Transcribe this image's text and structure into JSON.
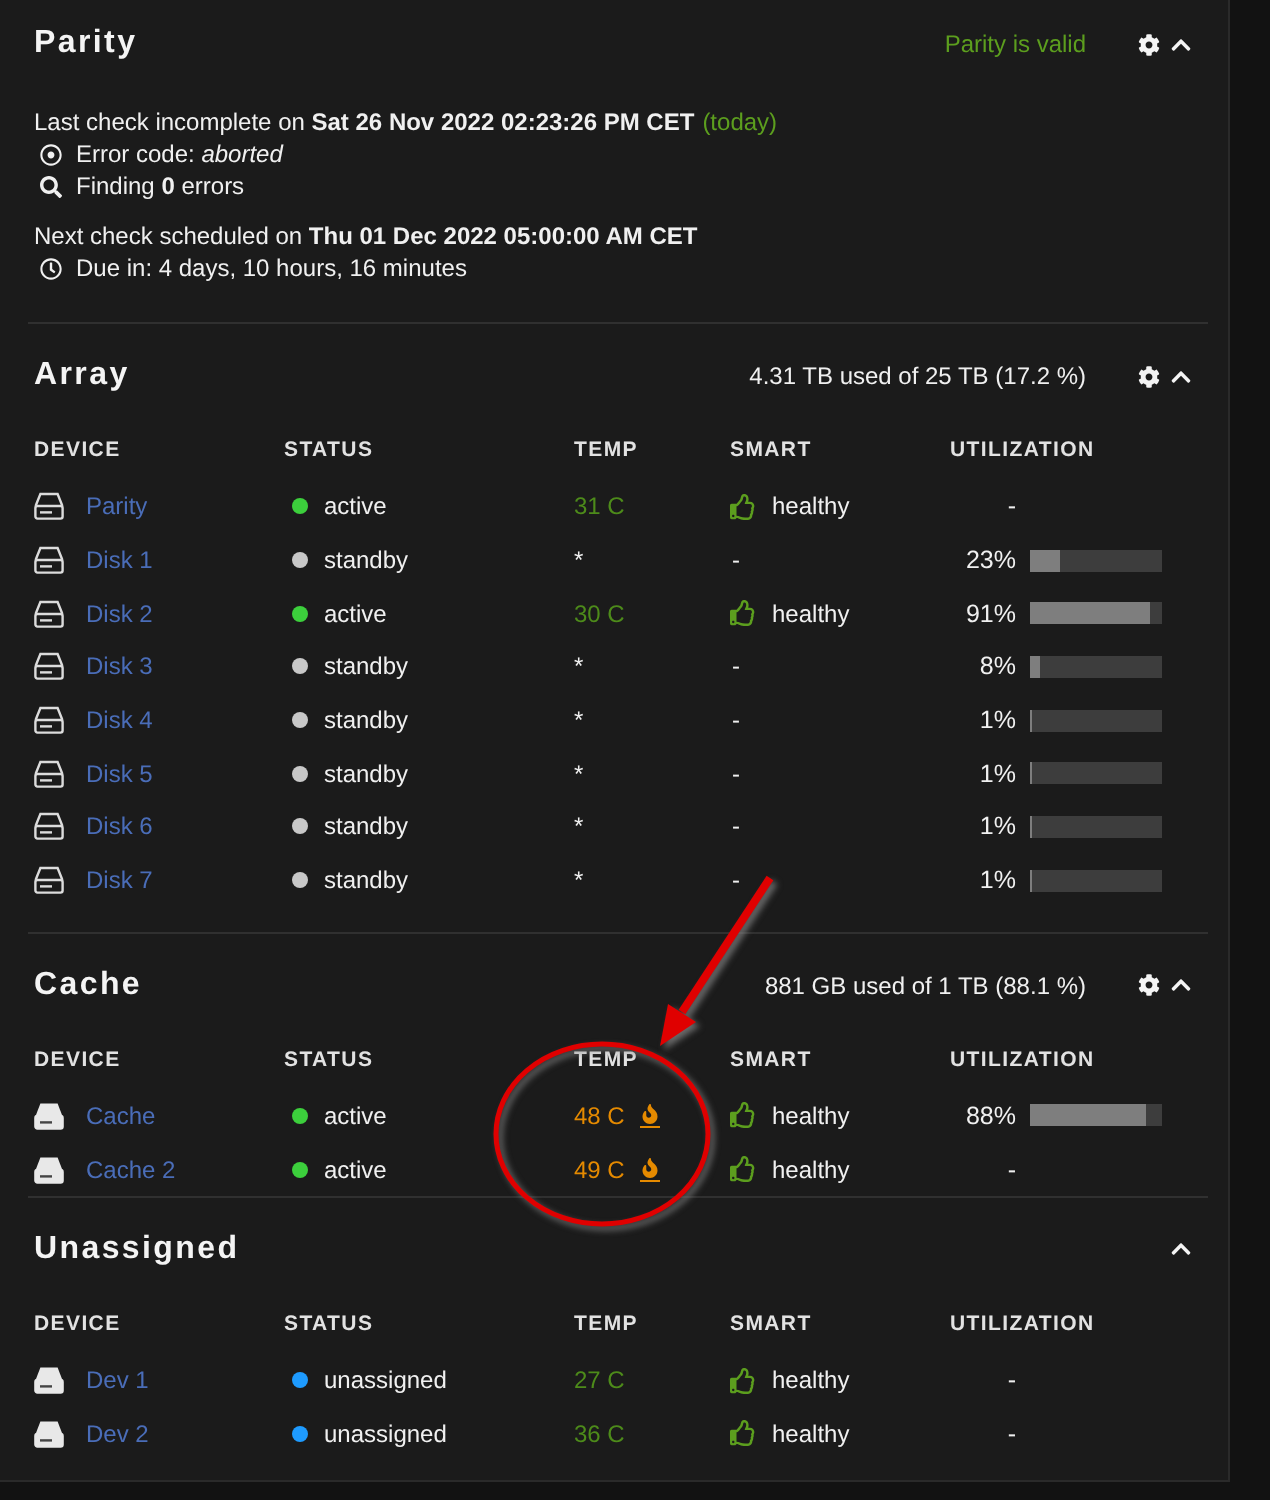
{
  "parity": {
    "title": "Parity",
    "status": "Parity is valid",
    "settings": true,
    "expanded": true,
    "last_check": {
      "text": "Last check incomplete on **Sat 26 Nov 2022 02:23:26 PM CET**",
      "note": "(today)",
      "details": [
        {
          "kind": "error",
          "text": "Error code: *aborted*"
        },
        {
          "kind": "search",
          "text": "Finding **0** errors"
        }
      ]
    },
    "next_check": {
      "text": "Next check scheduled on **Thu 01 Dec 2022 05:00:00 AM CET**",
      "details": [
        {
          "kind": "clock",
          "text": "Due in: 4 days, 10 hours, 16 minutes"
        }
      ]
    }
  },
  "sections": [
    {
      "kind": "array",
      "title": "Array",
      "summary": "4.31 TB used of 25 TB (17.2 %)",
      "settings": true,
      "expanded": true,
      "columns": [
        "DEVICE",
        "STATUS",
        "TEMP",
        "SMART",
        "UTILIZATION"
      ],
      "rows": [
        {
          "kind": "normal",
          "device": "Parity",
          "status": "active",
          "color": "#3ccf3c",
          "temp": "31 C",
          "smart": "healthy",
          "smart_ok": true,
          "utilization": "-"
        },
        {
          "kind": "standby",
          "device": "Disk 1",
          "status": "standby",
          "color": "#c8c8c8",
          "temp": "*",
          "smart": "-",
          "smart_ok": false,
          "utilization": "23%",
          "level": 0.23
        },
        {
          "kind": "normal",
          "device": "Disk 2",
          "status": "active",
          "color": "#3ccf3c",
          "temp": "30 C",
          "smart": "healthy",
          "smart_ok": true,
          "utilization": "91%",
          "level": 0.91
        },
        {
          "kind": "standby",
          "device": "Disk 3",
          "status": "standby",
          "color": "#c8c8c8",
          "temp": "*",
          "smart": "-",
          "smart_ok": false,
          "utilization": "8%",
          "level": 0.08
        },
        {
          "kind": "standby",
          "device": "Disk 4",
          "status": "standby",
          "color": "#c8c8c8",
          "temp": "*",
          "smart": "-",
          "smart_ok": false,
          "utilization": "1%",
          "level": 0.01
        },
        {
          "kind": "standby",
          "device": "Disk 5",
          "status": "standby",
          "color": "#c8c8c8",
          "temp": "*",
          "smart": "-",
          "smart_ok": false,
          "utilization": "1%",
          "level": 0.01
        },
        {
          "kind": "standby",
          "device": "Disk 6",
          "status": "standby",
          "color": "#c8c8c8",
          "temp": "*",
          "smart": "-",
          "smart_ok": false,
          "utilization": "1%",
          "level": 0.01
        },
        {
          "kind": "standby",
          "device": "Disk 7",
          "status": "standby",
          "color": "#c8c8c8",
          "temp": "*",
          "smart": "-",
          "smart_ok": false,
          "utilization": "1%",
          "level": 0.01
        }
      ]
    },
    {
      "kind": "pool",
      "title": "Cache",
      "summary": "881 GB used of 1 TB (88.1 %)",
      "settings": true,
      "expanded": true,
      "columns": [
        "DEVICE",
        "STATUS",
        "TEMP",
        "SMART",
        "UTILIZATION"
      ],
      "rows": [
        {
          "kind": "hot",
          "device": "Cache",
          "status": "active",
          "color": "#3ccf3c",
          "temp": "48 C",
          "smart": "healthy",
          "smart_ok": true,
          "utilization": "88%",
          "level": 0.88
        },
        {
          "kind": "hot",
          "device": "Cache 2",
          "status": "active",
          "color": "#3ccf3c",
          "temp": "49 C",
          "smart": "healthy",
          "smart_ok": true,
          "utilization": "-"
        }
      ]
    },
    {
      "kind": "unassigned",
      "title": "Unassigned",
      "expanded": true,
      "columns": [
        "DEVICE",
        "STATUS",
        "TEMP",
        "SMART",
        "UTILIZATION"
      ],
      "rows": [
        {
          "kind": "normal",
          "device": "Dev 1",
          "status": "unassigned",
          "color": "#1e9bff",
          "temp": "27 C",
          "smart": "healthy",
          "smart_ok": true,
          "utilization": "-"
        },
        {
          "kind": "normal",
          "device": "Dev 2",
          "status": "unassigned",
          "color": "#1e9bff",
          "temp": "36 C",
          "smart": "healthy",
          "smart_ok": true,
          "utilization": "-"
        }
      ]
    }
  ]
}
